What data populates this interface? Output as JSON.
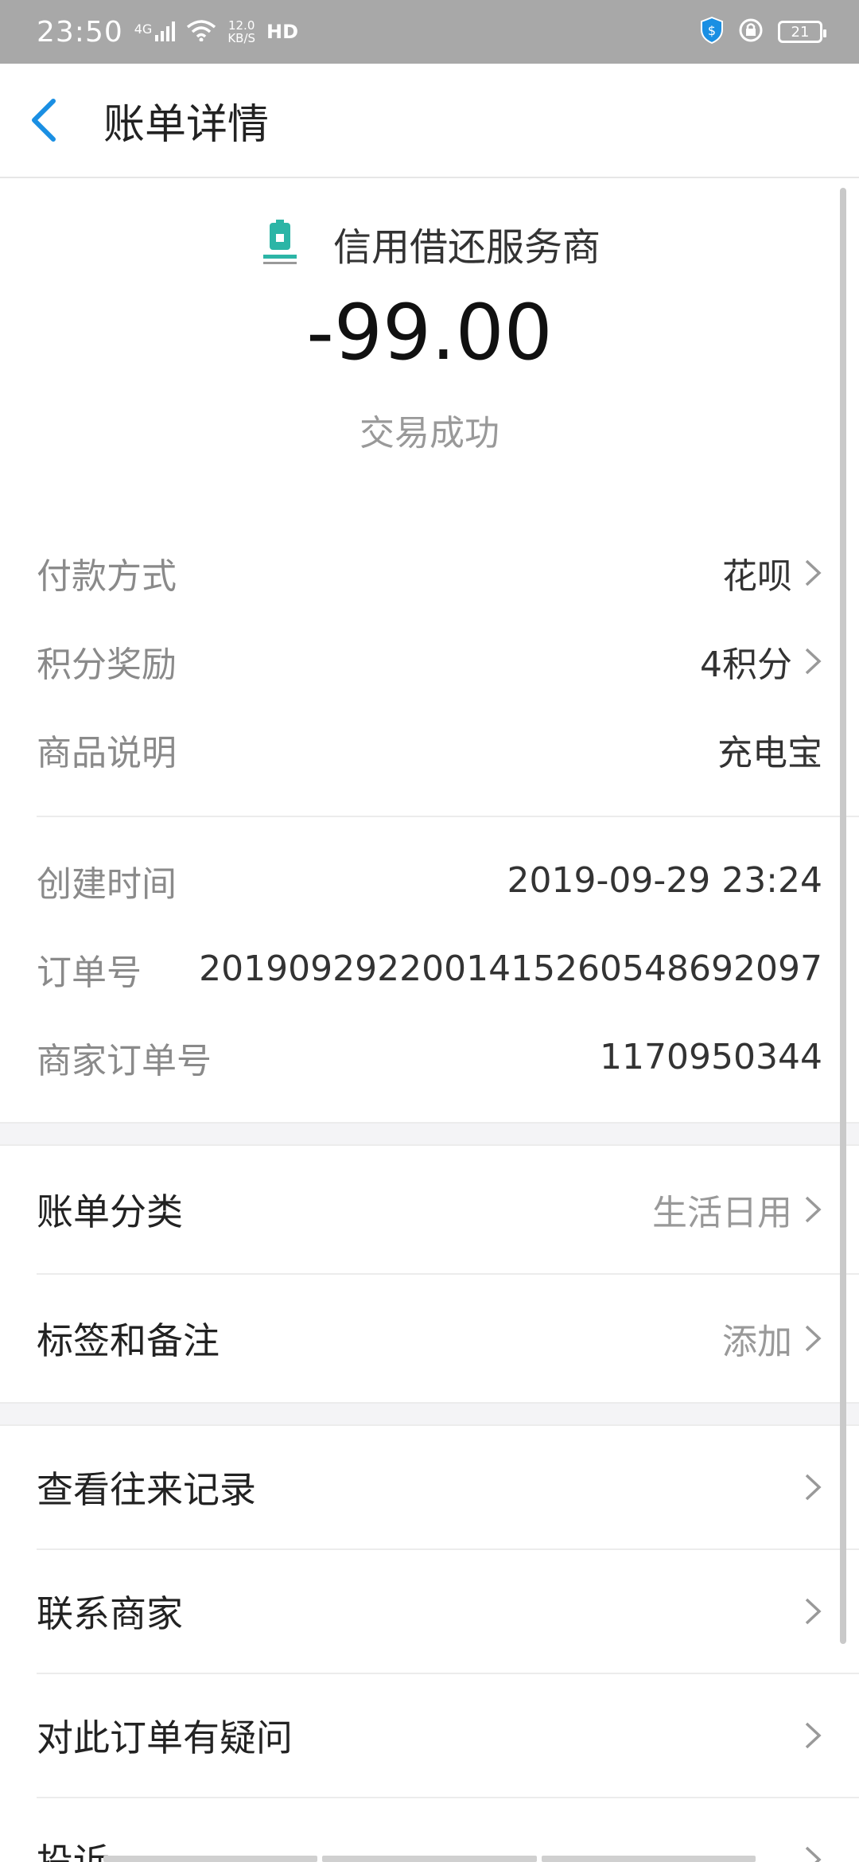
{
  "status_bar": {
    "time": "23:50",
    "network": "4G",
    "speed_value": "12.0",
    "speed_unit": "KB/S",
    "hd": "HD",
    "battery": "21"
  },
  "nav": {
    "title": "账单详情"
  },
  "merchant": {
    "name": "信用借还服务商"
  },
  "transaction": {
    "amount": "-99.00",
    "status": "交易成功"
  },
  "info": [
    {
      "label": "付款方式",
      "value": "花呗"
    },
    {
      "label": "积分奖励",
      "value": "4积分"
    },
    {
      "label": "商品说明",
      "value": "充电宝"
    }
  ],
  "details": [
    {
      "label": "创建时间",
      "value": "2019-09-29 23:24"
    },
    {
      "label": "订单号",
      "value": "2019092922001415260548692097"
    },
    {
      "label": "商家订单号",
      "value": "1170950344"
    }
  ],
  "bill": [
    {
      "label": "账单分类",
      "value": "生活日用"
    },
    {
      "label": "标签和备注",
      "value": "添加"
    }
  ],
  "actions": [
    {
      "label": "查看往来记录"
    },
    {
      "label": "联系商家"
    },
    {
      "label": "对此订单有疑问"
    },
    {
      "label": "投诉"
    }
  ],
  "colors": {
    "accent": "#1a8fe3",
    "status_bar_bg": "#a8a8a8",
    "logo_teal": "#2cb5a6"
  }
}
